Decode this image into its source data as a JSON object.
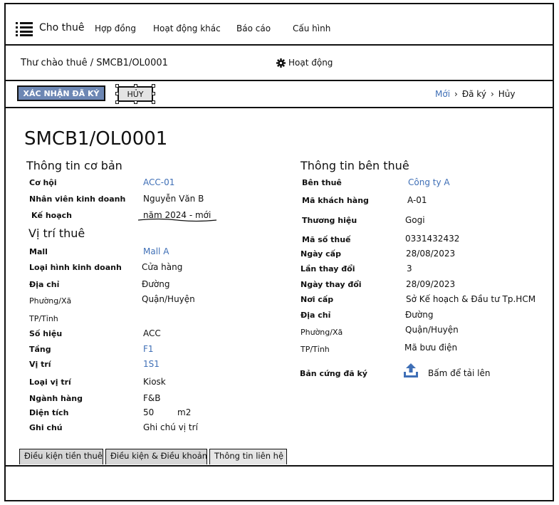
{
  "nav": {
    "brand": "Cho thuê",
    "links": [
      "Hợp đồng",
      "Hoạt động khác",
      "Báo cáo",
      "Cấu hình"
    ]
  },
  "breadcrumb": "Thư chào thuê / SMCB1/OL0001",
  "actions_label": "Hoạt động",
  "toolbar": {
    "confirm_label": "XÁC NHẬN ĐÃ KÝ",
    "cancel_label": "HỦY"
  },
  "status_steps": [
    "Mới",
    "Đã ký",
    "Hủy"
  ],
  "document": {
    "title": "SMCB1/OL0001"
  },
  "basic_info": {
    "title": "Thông tin cơ bản",
    "opportunity_label": "Cơ hội",
    "opportunity_value": "ACC-01",
    "salesperson_label": "Nhân viên kinh doanh",
    "salesperson_value": "Nguyễn Văn B",
    "plan_label": "Kế hoạch",
    "plan_value": "năm 2024 - mới"
  },
  "location": {
    "title": "Vị trí thuê",
    "mall_label": "Mall",
    "mall_value": "Mall A",
    "business_type_label": "Loại hình kinh doanh",
    "business_type_value": "Cửa hàng",
    "address_label": "Địa chỉ",
    "street_value": "Đường",
    "ward_label": "Phường/Xã",
    "district_value": "Quận/Huyện",
    "province_label": "TP/Tỉnh",
    "number_label": "Số hiệu",
    "number_value": "ACC",
    "floor_label": "Tầng",
    "floor_value": "F1",
    "position_label": "Vị trí",
    "position_value": "1S1",
    "position_type_label": "Loại vị trí",
    "position_type_value": "Kiosk",
    "industry_label": "Ngành hàng",
    "industry_value": "F&B",
    "area_label": "Diện tích",
    "area_value": "50",
    "area_unit": "m2",
    "note_label": "Ghi chú",
    "note_value": "Ghi chú vị trí"
  },
  "tenant": {
    "title": "Thông tin bên thuê",
    "tenant_label": "Bên thuê",
    "tenant_value": "Công ty A",
    "customer_code_label": "Mã khách hàng",
    "customer_code_value": "A-01",
    "brand_label": "Thương hiệu",
    "brand_value": "Gogi",
    "tax_code_label": "Mã số thuế",
    "tax_code_value": "0331432432",
    "issue_date_label": "Ngày cấp",
    "issue_date_value": "28/08/2023",
    "change_count_label": "Lần thay đổi",
    "change_count_value": "3",
    "change_date_label": "Ngày thay đổi",
    "change_date_value": "28/09/2023",
    "issuer_label": "Nơi cấp",
    "issuer_value": "Sở Kế hoạch & Đầu tư Tp.HCM",
    "address_label": "Địa chỉ",
    "street_value": "Đường",
    "ward_label": "Phường/Xã",
    "district_value": "Quận/Huyện",
    "province_label": "TP/Tỉnh",
    "postal_value": "Mã bưu điện",
    "signed_copy_label": "Bản cứng đã ký",
    "upload_label": "Bấm để tải lên"
  },
  "tabs": [
    "Điều kiện tiền thuê",
    "Điều kiện & Điều khoản",
    "Thông tin liên hệ"
  ],
  "colors": {
    "link": "#3f6fb6",
    "confirm_button": "#6d87b4"
  }
}
